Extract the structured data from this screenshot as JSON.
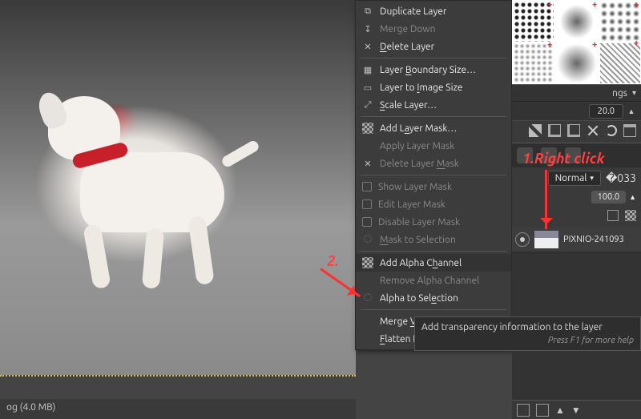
{
  "menu": {
    "duplicate": "Duplicate Layer",
    "merge_down": "Merge Down",
    "delete_layer": "Delete Layer",
    "boundary": "Layer Boundary Size…",
    "to_image": "Layer to Image Size",
    "scale": "Scale Layer…",
    "add_mask": "Add Layer Mask…",
    "apply_mask": "Apply Layer Mask",
    "delete_mask": "Delete Layer Mask",
    "show_mask": "Show Layer Mask",
    "edit_mask": "Edit Layer Mask",
    "disable_mask": "Disable Layer Mask",
    "mask_to_sel": "Mask to Selection",
    "add_alpha": "Add Alpha Channel",
    "remove_alpha": "Remove Alpha Channel",
    "alpha_to_sel": "Alpha to Selection",
    "merge_visible": "Merge Visible Layers…",
    "flatten": "Flatten Image"
  },
  "underline": {
    "duplicate": "u",
    "merge_down": "w",
    "delete_layer": "D",
    "boundary": "B",
    "to_image": "I",
    "scale": "S",
    "add_mask": "a",
    "delete_mask": "M",
    "mask_to_sel": "M",
    "add_alpha": "h",
    "remove_alpha": "l",
    "alpha_to_sel": "e",
    "merge_visible": "V",
    "flatten": "F"
  },
  "right_panel": {
    "combo_label": "ngs",
    "spacing_value": "20.0",
    "mode_label": "Normal",
    "opacity_value": "100.0"
  },
  "layers": {
    "layer_name": "PIXNIO-241093"
  },
  "tooltip": {
    "text": "Add transparency information to the layer",
    "hint": "Press F1 for more help"
  },
  "annotations": {
    "a1": "1.Right click",
    "a2": "2."
  },
  "statusbar": {
    "text": "og (4.0 MB)"
  }
}
